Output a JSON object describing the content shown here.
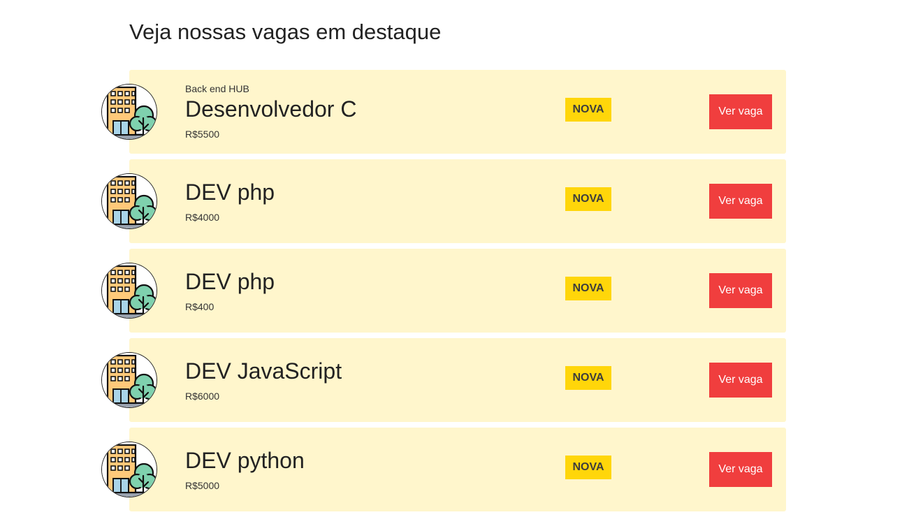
{
  "page": {
    "title": "Veja nossas vagas em destaque"
  },
  "jobs": [
    {
      "company": "Back end HUB",
      "title": "Desenvolvedor C",
      "salary": "R$5500",
      "badge": "NOVA",
      "button": "Ver vaga",
      "logo_icon": "office-building-icon"
    },
    {
      "company": "",
      "title": "DEV php",
      "salary": "R$4000",
      "badge": "NOVA",
      "button": "Ver vaga",
      "logo_icon": "office-building-icon"
    },
    {
      "company": "",
      "title": "DEV php",
      "salary": "R$400",
      "badge": "NOVA",
      "button": "Ver vaga",
      "logo_icon": "office-building-icon"
    },
    {
      "company": "",
      "title": "DEV JavaScript",
      "salary": "R$6000",
      "badge": "NOVA",
      "button": "Ver vaga",
      "logo_icon": "office-building-icon"
    },
    {
      "company": "",
      "title": "DEV python",
      "salary": "R$5000",
      "badge": "NOVA",
      "button": "Ver vaga",
      "logo_icon": "office-building-icon"
    }
  ],
  "colors": {
    "card_background": "#fff6cc",
    "badge_background": "#ffd60a",
    "button_background": "#f03e3e",
    "text": "#222222"
  }
}
